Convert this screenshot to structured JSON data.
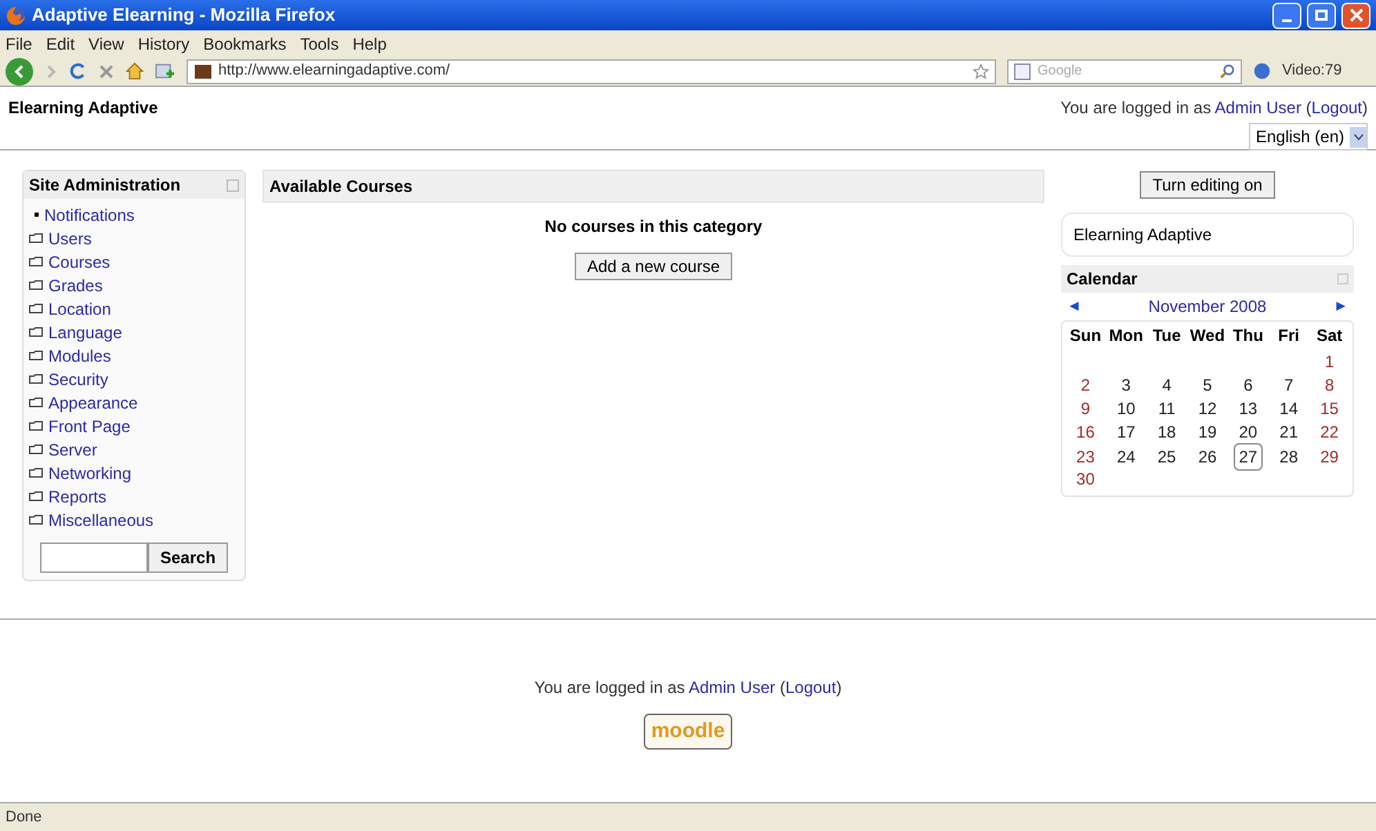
{
  "window": {
    "title": "Adaptive Elearning - Mozilla Firefox"
  },
  "menu": [
    "File",
    "Edit",
    "View",
    "History",
    "Bookmarks",
    "Tools",
    "Help"
  ],
  "toolbar": {
    "url": "http://www.elearningadaptive.com/",
    "search_placeholder": "Google",
    "video_label": "Video:79"
  },
  "header": {
    "site_name": "Elearning Adaptive",
    "login": {
      "prefix": "You are logged in as",
      "user": "Admin User",
      "open": "(",
      "logout": "Logout",
      "close": ")"
    },
    "language": "English (en)"
  },
  "admin_block": {
    "title": "Site Administration",
    "items": [
      {
        "label": "Notifications",
        "kind": "bullet"
      },
      {
        "label": "Users",
        "kind": "folder"
      },
      {
        "label": "Courses",
        "kind": "folder"
      },
      {
        "label": "Grades",
        "kind": "folder"
      },
      {
        "label": "Location",
        "kind": "folder"
      },
      {
        "label": "Language",
        "kind": "folder"
      },
      {
        "label": "Modules",
        "kind": "folder"
      },
      {
        "label": "Security",
        "kind": "folder"
      },
      {
        "label": "Appearance",
        "kind": "folder"
      },
      {
        "label": "Front Page",
        "kind": "folder"
      },
      {
        "label": "Server",
        "kind": "folder"
      },
      {
        "label": "Networking",
        "kind": "folder"
      },
      {
        "label": "Reports",
        "kind": "folder"
      },
      {
        "label": "Miscellaneous",
        "kind": "folder"
      }
    ],
    "search_button": "Search"
  },
  "courses": {
    "title": "Available Courses",
    "message": "No courses in this category",
    "add_button": "Add a new course"
  },
  "editing_button": "Turn editing on",
  "site_block": {
    "name": "Elearning Adaptive"
  },
  "calendar": {
    "title": "Calendar",
    "prev": "◄",
    "month": "November 2008",
    "next": "►",
    "weekdays": [
      "Sun",
      "Mon",
      "Tue",
      "Wed",
      "Thu",
      "Fri",
      "Sat"
    ],
    "weeks": [
      [
        {
          "d": "1",
          "today": false
        }
      ],
      [
        {
          "d": "2",
          "today": false
        },
        {
          "d": "3",
          "today": false
        },
        {
          "d": "4",
          "today": false
        },
        {
          "d": "5",
          "today": false
        },
        {
          "d": "6",
          "today": false
        },
        {
          "d": "7",
          "today": false
        },
        {
          "d": "8",
          "today": false
        }
      ],
      [
        {
          "d": "9",
          "today": false
        },
        {
          "d": "10",
          "today": false
        },
        {
          "d": "11",
          "today": false
        },
        {
          "d": "12",
          "today": false
        },
        {
          "d": "13",
          "today": false
        },
        {
          "d": "14",
          "today": false
        },
        {
          "d": "15",
          "today": false
        }
      ],
      [
        {
          "d": "16",
          "today": false
        },
        {
          "d": "17",
          "today": false
        },
        {
          "d": "18",
          "today": false
        },
        {
          "d": "19",
          "today": false
        },
        {
          "d": "20",
          "today": false
        },
        {
          "d": "21",
          "today": false
        },
        {
          "d": "22",
          "today": false
        }
      ],
      [
        {
          "d": "23",
          "today": false
        },
        {
          "d": "24",
          "today": false
        },
        {
          "d": "25",
          "today": false
        },
        {
          "d": "26",
          "today": false
        },
        {
          "d": "27",
          "today": true
        },
        {
          "d": "28",
          "today": false
        },
        {
          "d": "29",
          "today": false
        }
      ],
      [
        {
          "d": "30",
          "today": false
        }
      ]
    ]
  },
  "footer": {
    "login": {
      "prefix": "You are logged in as",
      "user": "Admin User",
      "open": "(",
      "logout": "Logout",
      "close": ")"
    },
    "logo": "moodle"
  },
  "status_bar": "Done"
}
